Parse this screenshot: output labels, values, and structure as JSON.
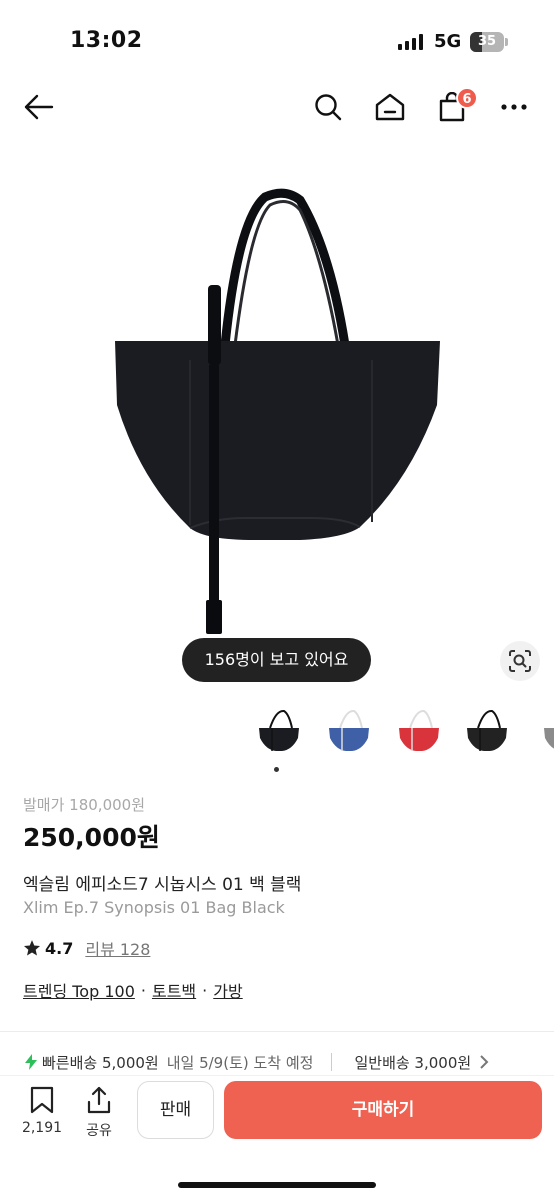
{
  "status_bar": {
    "time": "13:02",
    "network": "5G",
    "battery": "35",
    "battery_level": 0.35
  },
  "nav": {
    "cart_count": "6"
  },
  "hero": {
    "viewer_count_text": "156명이 보고 있어요"
  },
  "thumbnails": [
    {
      "color": "#1a1c22",
      "selected": true
    },
    {
      "color": "#3f5fa6",
      "selected": false
    },
    {
      "color": "#d9333b",
      "selected": false
    },
    {
      "color": "#222222",
      "selected": false
    },
    {
      "color": "#8b8b8b",
      "selected": false
    }
  ],
  "product": {
    "original_price": "발매가 180,000원",
    "price": "250,000원",
    "name_ko": "엑슬림 에피소드7 시놉시스 01 백 블랙",
    "name_en": "Xlim Ep.7 Synopsis 01 Bag Black",
    "rating": "4.7",
    "review_label": "리뷰 128",
    "tags": [
      "트렌딩 Top 100",
      "토트백",
      "가방"
    ],
    "tag_separator": "·"
  },
  "shipping": {
    "fast_label": "빠른배송 5,000원",
    "fast_eta": "내일 5/9(토) 도착 예정",
    "normal_label": "일반배송 3,000원"
  },
  "bottom_bar": {
    "bookmark_count": "2,191",
    "share_label": "공유",
    "sell_label": "판매",
    "buy_label": "구매하기"
  },
  "colors": {
    "accent": "#ef6150",
    "badge": "#ef5b4c",
    "bolt": "#2fbf5a"
  }
}
